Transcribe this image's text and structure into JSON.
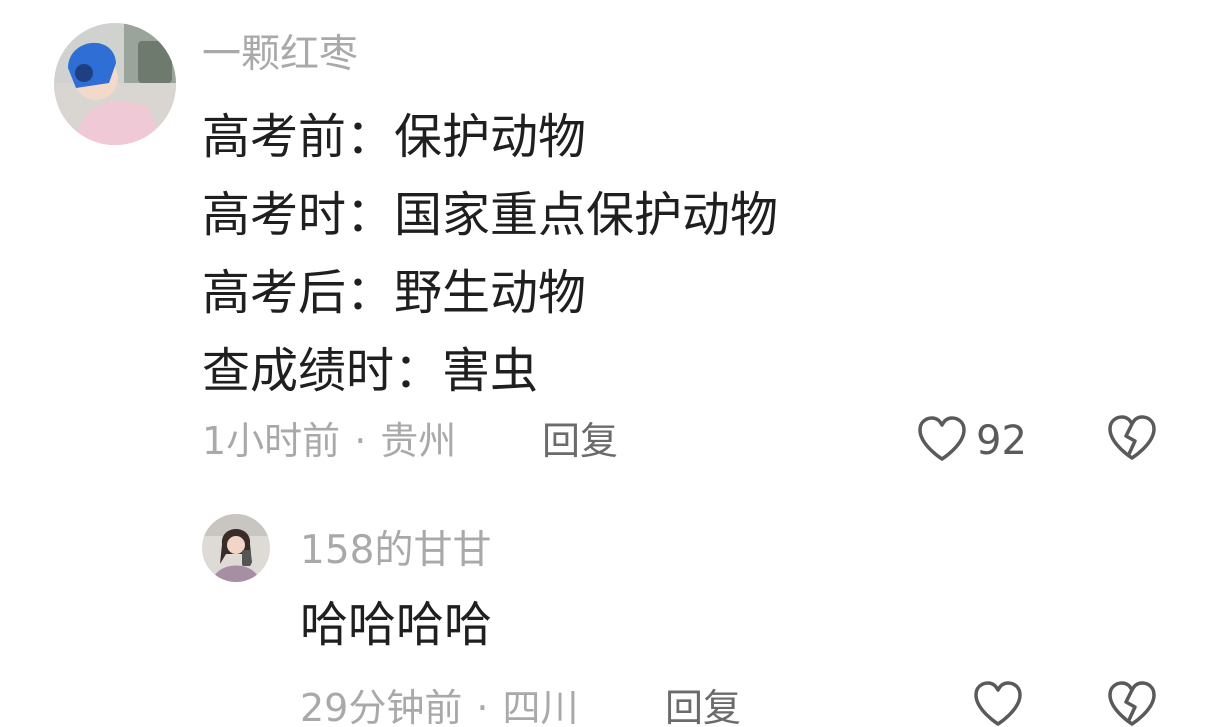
{
  "comments": [
    {
      "username": "一颗红枣",
      "lines": [
        "高考前：保护动物",
        "高考时：国家重点保护动物",
        "高考后：野生动物",
        "查成绩时：害虫"
      ],
      "time": "1小时前",
      "separator": "·",
      "location": "贵州",
      "reply_label": "回复",
      "like_count": "92",
      "like_icon": "heart-outline-icon",
      "dislike_icon": "broken-heart-icon"
    }
  ],
  "replies": [
    {
      "username": "158的甘甘",
      "text": "哈哈哈哈",
      "time": "29分钟前",
      "separator": "·",
      "location": "四川",
      "reply_label": "回复",
      "like_icon": "heart-outline-icon",
      "dislike_icon": "broken-heart-icon"
    }
  ]
}
